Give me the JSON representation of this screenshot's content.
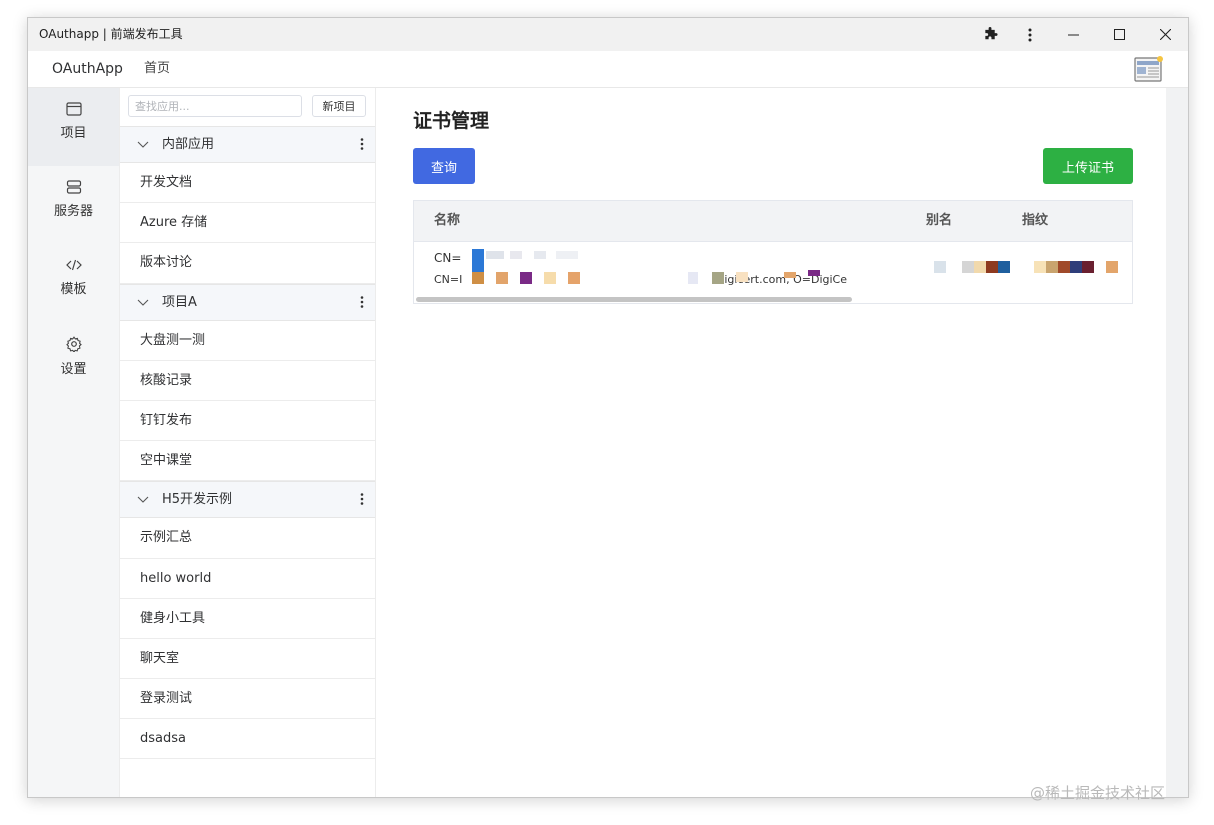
{
  "window": {
    "title": "OAuthapp | 前端发布工具"
  },
  "menubar": {
    "app_name": "OAuthApp",
    "home": "首页"
  },
  "iconbar": {
    "items": [
      {
        "label": "项目",
        "icon": "window-icon",
        "active": true
      },
      {
        "label": "服务器",
        "icon": "server-icon",
        "active": false
      },
      {
        "label": "模板",
        "icon": "code-icon",
        "active": false
      },
      {
        "label": "设置",
        "icon": "gear-icon",
        "active": false
      }
    ]
  },
  "projects": {
    "search_placeholder": "查找应用...",
    "new_button": "新项目",
    "groups": [
      {
        "name": "内部应用",
        "items": [
          "开发文档",
          "Azure 存储",
          "版本讨论"
        ]
      },
      {
        "name": "项目A",
        "items": [
          "大盘测一测",
          "核酸记录",
          "钉钉发布",
          "空中课堂"
        ]
      },
      {
        "name": "H5开发示例",
        "items": [
          "示例汇总",
          "hello world",
          "健身小工具",
          "聊天室",
          "登录测试",
          "dsadsa"
        ]
      }
    ]
  },
  "main": {
    "title": "证书管理",
    "query_button": "查询",
    "upload_button": "上传证书",
    "table": {
      "columns": [
        "名称",
        "别名",
        "指纹"
      ],
      "row": {
        "name_line1": "CN=",
        "name_line2_prefix": "CN=I",
        "name_line2_suffix": "igicert.com, O=DigiCe"
      }
    }
  },
  "watermark": "@稀土掘金技术社区",
  "colors": {
    "primary": "#4169e1",
    "success": "#2db043"
  }
}
